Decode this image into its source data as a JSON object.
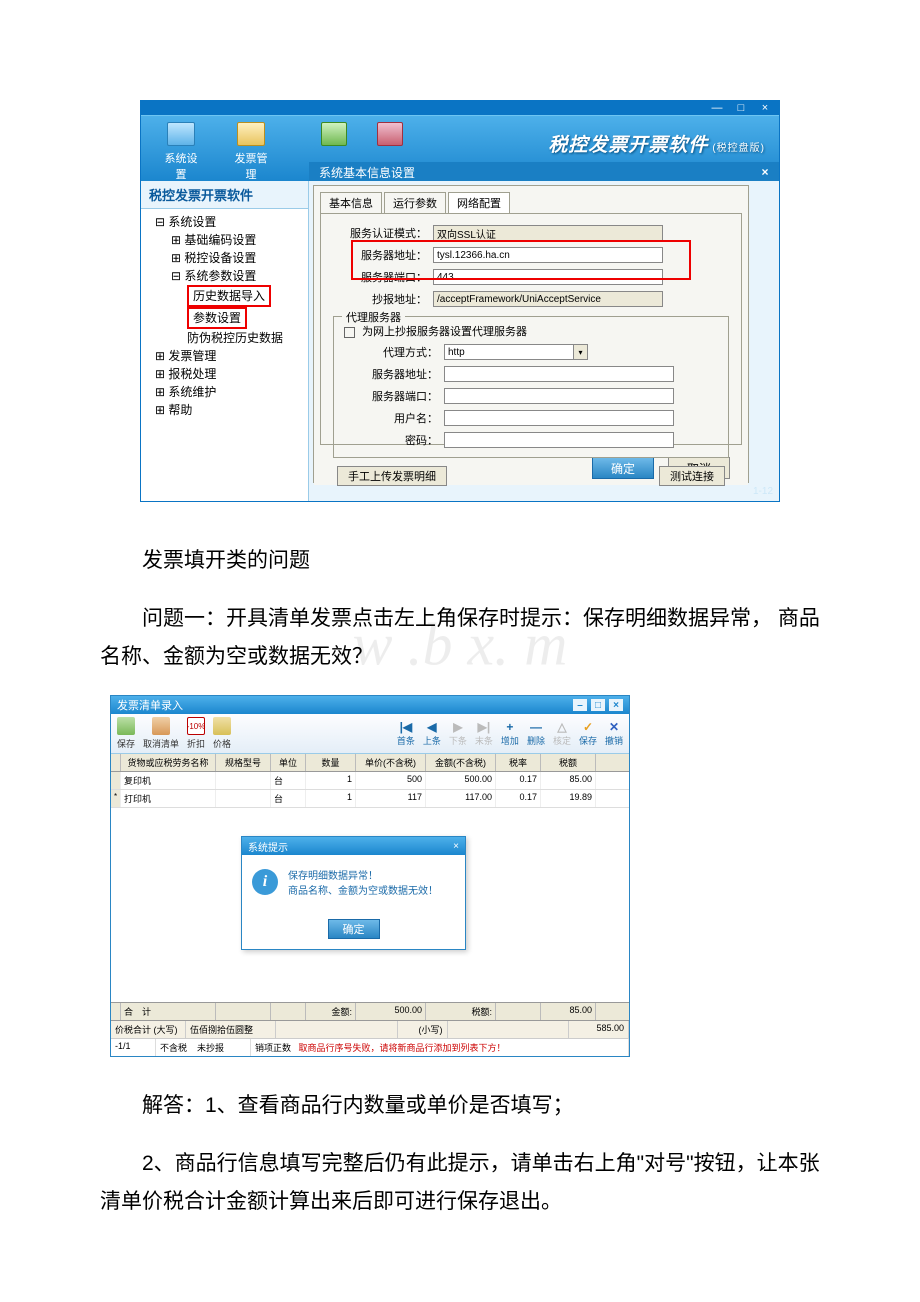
{
  "app": {
    "titlebar_buttons": {
      "min": "—",
      "max": "□",
      "close": "×"
    },
    "brand": "税控发票开票软件",
    "brand_suffix": "(税控盘版)",
    "top_icons": [
      {
        "name": "system-settings-icon",
        "label": "系统设置"
      },
      {
        "name": "invoice-manage-icon",
        "label": "发票管理"
      }
    ],
    "mid_icons": [
      {
        "name": "green-icon"
      },
      {
        "name": "tool-icon"
      }
    ],
    "blue_strip_title": "系统基本信息设置",
    "version_label": "1-12"
  },
  "sidebar": {
    "title": "税控发票开票软件",
    "tree": {
      "root": "系统设置",
      "items": [
        "基础编码设置",
        "税控设备设置"
      ],
      "param_node": "系统参数设置",
      "param_children": [
        "历史数据导入",
        "参数设置",
        "防伪税控历史数据"
      ],
      "rest": [
        "发票管理",
        "报税处理",
        "系统维护",
        "帮助"
      ]
    }
  },
  "dialog": {
    "tabs": [
      "基本信息",
      "运行参数",
      "网络配置"
    ],
    "active_tab": 2,
    "rows": {
      "auth_mode": {
        "label": "服务认证模式：",
        "value": "双向SSL认证"
      },
      "server_addr": {
        "label": "服务器地址：",
        "value": "tysl.12366.ha.cn"
      },
      "server_port": {
        "label": "服务器端口：",
        "value": "443"
      },
      "tax_addr": {
        "label": "抄报地址：",
        "value": "/acceptFramework/UniAcceptService"
      }
    },
    "proxy": {
      "legend": "代理服务器",
      "checkbox_label": "为网上抄报服务器设置代理服务器",
      "mode": {
        "label": "代理方式：",
        "value": "http"
      },
      "addr": {
        "label": "服务器地址：",
        "value": ""
      },
      "port": {
        "label": "服务器端口：",
        "value": ""
      },
      "user": {
        "label": "用户名：",
        "value": ""
      },
      "pass": {
        "label": "密码：",
        "value": ""
      }
    },
    "buttons": {
      "upload": "手工上传发票明细",
      "test": "测试连接",
      "ok": "确定",
      "cancel": "取消"
    }
  },
  "doc": {
    "section_title": "发票填开类的问题",
    "q1": "问题一：开具清单发票点击左上角保存时提示：保存明细数据异常， 商品名称、金额为空或数据无效？",
    "watermark": "w  .b   x.   m",
    "a1": "解答：1、查看商品行内数量或单价是否填写；",
    "a2": "2、商品行信息填写完整后仍有此提示，请单击右上角\"对号\"按钮，让本张清单价税合计金额计算出来后即可进行保存退出。"
  },
  "list": {
    "title": "发票清单录入",
    "toolbar_left": [
      {
        "name": "save-button",
        "label": "保存",
        "cls": "ti-save"
      },
      {
        "name": "cancel-list-button",
        "label": "取消清单",
        "cls": "ti-cancel"
      },
      {
        "name": "discount-button",
        "label": "折扣",
        "cls": "ti-discount",
        "text": "-10%"
      },
      {
        "name": "price-button",
        "label": "价格",
        "cls": "ti-price"
      }
    ],
    "toolbar_right": [
      {
        "name": "nav-first",
        "label": "首条",
        "glyph": "|◀",
        "disabled": false
      },
      {
        "name": "nav-prev",
        "label": "上条",
        "glyph": "◀",
        "disabled": false
      },
      {
        "name": "nav-next",
        "label": "下条",
        "glyph": "▶",
        "disabled": true
      },
      {
        "name": "nav-last",
        "label": "末条",
        "glyph": "▶|",
        "disabled": true
      },
      {
        "name": "nav-add",
        "label": "增加",
        "glyph": "+",
        "disabled": false
      },
      {
        "name": "nav-delete",
        "label": "删除",
        "glyph": "—",
        "disabled": false
      },
      {
        "name": "nav-check",
        "label": "核定",
        "glyph": "△",
        "disabled": true
      },
      {
        "name": "nav-confirm",
        "label": "保存",
        "glyph": "✓",
        "cls": "ni-save",
        "disabled": false
      },
      {
        "name": "nav-void",
        "label": "撤销",
        "glyph": "✕",
        "cls": "ni-void",
        "disabled": false
      }
    ],
    "columns": [
      "",
      "货物或应税劳务名称",
      "规格型号",
      "单位",
      "数量",
      "单价(不含税)",
      "金额(不含税)",
      "税率",
      "税额"
    ],
    "rows": [
      {
        "mark": "",
        "name": "复印机",
        "model": "",
        "unit": "台",
        "qty": "1",
        "price": "500",
        "amount": "500.00",
        "rate": "0.17",
        "tax": "85.00"
      },
      {
        "mark": "*",
        "name": "打印机",
        "model": "",
        "unit": "台",
        "qty": "1",
        "price": "117",
        "amount": "117.00",
        "rate": "0.17",
        "tax": "19.89"
      }
    ],
    "footer": {
      "sum_label": "合　计",
      "amount_label": "金额:",
      "amount": "500.00",
      "tax_label": "税额:",
      "tax": "85.00"
    },
    "total_row": {
      "label": "价税合计 (大写)",
      "upper": "伍佰捌拾伍圆整",
      "lower_label": "(小写)",
      "lower": "585.00"
    },
    "status": {
      "page": "-1/1",
      "tax_mode": "不含税",
      "copy_mode": "未抄报",
      "sales_qty_label": "销项正数",
      "msg": "取商品行序号失败，请将新商品行添加到列表下方！"
    },
    "prompt": {
      "title": "系统提示",
      "close": "×",
      "line1": "保存明细数据异常！",
      "line2": "商品名称、金额为空或数据无效！",
      "ok": "确定"
    }
  }
}
